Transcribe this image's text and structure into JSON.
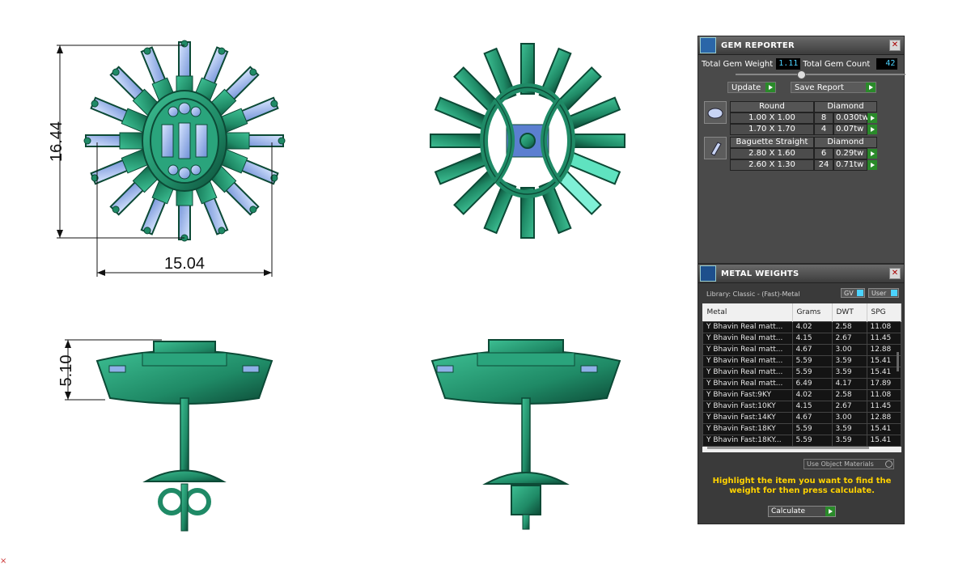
{
  "dimensions": {
    "height_top": "16.44",
    "width_top": "15.04",
    "height_side": "5.10"
  },
  "gem_reporter": {
    "title": "GEM REPORTER",
    "total_weight_label": "Total Gem Weight",
    "total_weight": "1.11",
    "total_count_label": "Total Gem Count",
    "total_count": "42",
    "update_label": "Update",
    "save_label": "Save Report",
    "groups": [
      {
        "shape": "Round",
        "material": "Diamond",
        "rows": [
          {
            "size": "1.00 X 1.00",
            "count": "8",
            "weight": "0.030tw"
          },
          {
            "size": "1.70 X 1.70",
            "count": "4",
            "weight": "0.07tw"
          }
        ]
      },
      {
        "shape": "Baguette Straight",
        "material": "Diamond",
        "rows": [
          {
            "size": "2.80 X 1.60",
            "count": "6",
            "weight": "0.29tw"
          },
          {
            "size": "2.60 X 1.30",
            "count": "24",
            "weight": "0.71tw"
          }
        ]
      }
    ]
  },
  "metal_weights": {
    "title": "METAL WEIGHTS",
    "library": "Library: Classic - (Fast)-Metal",
    "gv_label": "GV",
    "user_label": "User",
    "columns": [
      "Metal",
      "Grams",
      "DWT",
      "SPG"
    ],
    "rows": [
      [
        "Y Bhavin Real matt...",
        "4.02",
        "2.58",
        "11.08"
      ],
      [
        "Y Bhavin Real matt...",
        "4.15",
        "2.67",
        "11.45"
      ],
      [
        "Y Bhavin Real matt...",
        "4.67",
        "3.00",
        "12.88"
      ],
      [
        "Y Bhavin Real matt...",
        "5.59",
        "3.59",
        "15.41"
      ],
      [
        "Y Bhavin Real matt...",
        "5.59",
        "3.59",
        "15.41"
      ],
      [
        "Y Bhavin Real matt...",
        "6.49",
        "4.17",
        "17.89"
      ],
      [
        "Y Bhavin Fast:9KY",
        "4.02",
        "2.58",
        "11.08"
      ],
      [
        "Y Bhavin Fast:10KY",
        "4.15",
        "2.67",
        "11.45"
      ],
      [
        "Y Bhavin Fast:14KY",
        "4.67",
        "3.00",
        "12.88"
      ],
      [
        "Y Bhavin Fast:18KY",
        "5.59",
        "3.59",
        "15.41"
      ],
      [
        "Y Bhavin Fast:18KY...",
        "5.59",
        "3.59",
        "15.41"
      ]
    ],
    "use_object_label": "Use Object Materials",
    "hint": "Highlight the item you want to find the weight for then press calculate.",
    "calculate_label": "Calculate"
  },
  "colors": {
    "metal": "#1f8a66",
    "stone": "#8fb0e8",
    "panel": "#4a4a4a",
    "accent_value": "#4cd3ff",
    "hint": "#ffd200"
  }
}
